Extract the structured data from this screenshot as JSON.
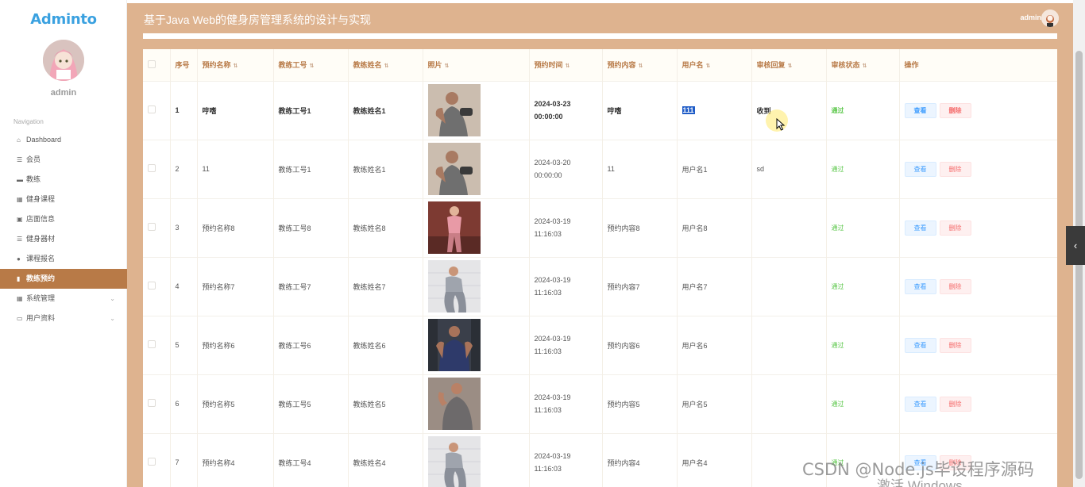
{
  "app": {
    "logo": "Adminto",
    "username": "admin",
    "header_title": "基于Java Web的健身房管理系统的设计与实现",
    "header_user": "admin"
  },
  "sidebar": {
    "nav_title": "Navigation",
    "items": [
      {
        "label": "Dashboard",
        "icon": "home-icon",
        "active": false
      },
      {
        "label": "会员",
        "icon": "list-icon",
        "active": false
      },
      {
        "label": "教练",
        "icon": "monitor-icon",
        "active": false
      },
      {
        "label": "健身课程",
        "icon": "grid-icon",
        "active": false
      },
      {
        "label": "店面信息",
        "icon": "clipboard-icon",
        "active": false
      },
      {
        "label": "健身器材",
        "icon": "list-icon",
        "active": false
      },
      {
        "label": "课程报名",
        "icon": "user-icon",
        "active": false
      },
      {
        "label": "教练预约",
        "icon": "file-icon",
        "active": true
      },
      {
        "label": "系统管理",
        "icon": "grid-icon",
        "active": false,
        "expandable": true
      },
      {
        "label": "用户资料",
        "icon": "card-icon",
        "active": false,
        "expandable": true
      }
    ]
  },
  "table": {
    "headers": [
      "序号",
      "预约名称",
      "教练工号",
      "教练姓名",
      "照片",
      "预约时间",
      "预约内容",
      "用户名",
      "审核回复",
      "审核状态",
      "操作"
    ],
    "view_label": "查看",
    "delete_label": "删除",
    "rows": [
      {
        "no": "1",
        "name": "哼嗜",
        "coach_id": "教练工号1",
        "coach_name": "教练姓名1",
        "photo": "man-dumbbell-photo",
        "time": "2024-03-23 00:00:00",
        "content": "哼嗜",
        "user": "111",
        "reply": "收到",
        "status": "通过"
      },
      {
        "no": "2",
        "name": "11",
        "coach_id": "教练工号1",
        "coach_name": "教练姓名1",
        "photo": "man-dumbbell-photo",
        "time": "2024-03-20 00:00:00",
        "content": "11",
        "user": "用户名1",
        "reply": "sd",
        "status": "通过"
      },
      {
        "no": "3",
        "name": "预约名称8",
        "coach_id": "教练工号8",
        "coach_name": "教练姓名8",
        "photo": "woman-pink-photo",
        "time": "2024-03-19 11:16:03",
        "content": "预约内容8",
        "user": "用户名8",
        "reply": "",
        "status": "通过"
      },
      {
        "no": "4",
        "name": "预约名称7",
        "coach_id": "教练工号7",
        "coach_name": "教练姓名7",
        "photo": "woman-grey-photo",
        "time": "2024-03-19 11:16:03",
        "content": "预约内容7",
        "user": "用户名7",
        "reply": "",
        "status": "通过"
      },
      {
        "no": "5",
        "name": "预约名称6",
        "coach_id": "教练工号6",
        "coach_name": "教练姓名6",
        "photo": "man-gym-photo",
        "time": "2024-03-19 11:16:03",
        "content": "预约内容6",
        "user": "用户名6",
        "reply": "",
        "status": "通过"
      },
      {
        "no": "6",
        "name": "预约名称5",
        "coach_id": "教练工号5",
        "coach_name": "教练姓名5",
        "photo": "man-flex-photo",
        "time": "2024-03-19 11:16:03",
        "content": "预约内容5",
        "user": "用户名5",
        "reply": "",
        "status": "通过"
      },
      {
        "no": "7",
        "name": "预约名称4",
        "coach_id": "教练工号4",
        "coach_name": "教练姓名4",
        "photo": "woman-grey-photo",
        "time": "2024-03-19 11:16:03",
        "content": "预约内容4",
        "user": "用户名4",
        "reply": "",
        "status": "通过"
      }
    ]
  },
  "overlay": {
    "watermark": "CSDN @Node.js毕设程序源码",
    "activate": "激活 Windows"
  },
  "colors": {
    "accent": "#deb38f",
    "active_nav": "#b87a47",
    "status_green": "#5bc74a",
    "view_blue": "#409eff",
    "delete_red": "#f56c6c"
  }
}
